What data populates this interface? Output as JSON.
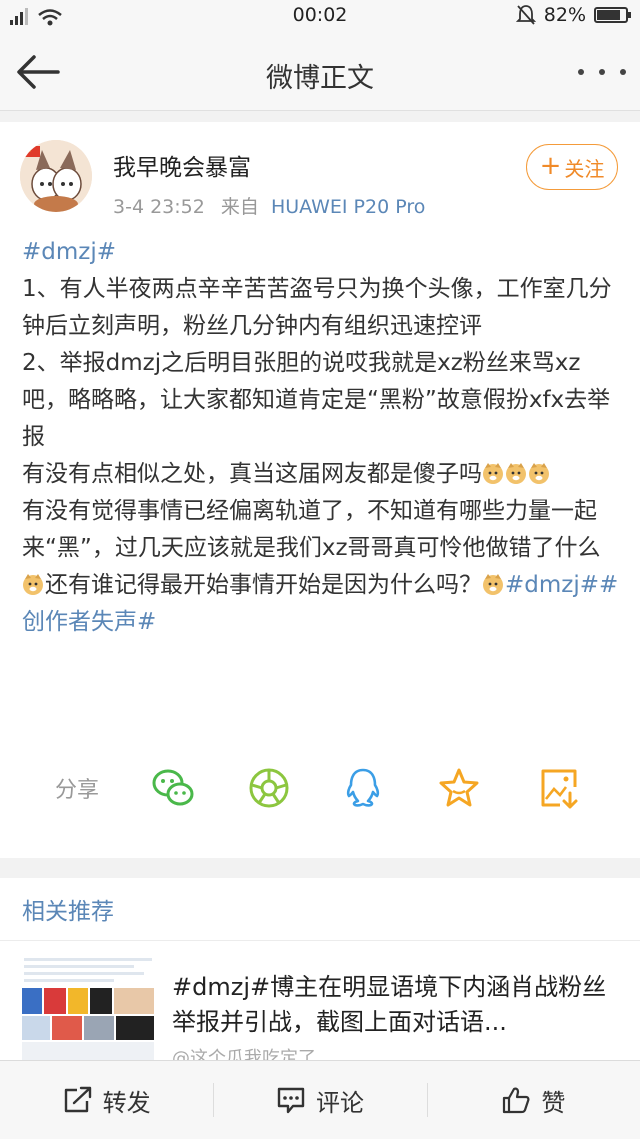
{
  "status": {
    "time": "00:02",
    "battery": "82%",
    "battery_level": 0.82
  },
  "nav": {
    "title": "微博正文"
  },
  "post": {
    "username": "我早晚会暴富",
    "time": "3-4 23:52",
    "source_prefix": "来自",
    "device": "HUAWEI P20 Pro",
    "follow_plus": "+",
    "follow_label": "关注",
    "tag1": "#dmzj#",
    "p1": "1、有人半夜两点辛辛苦苦盗号只为换个头像，工作室几分钟后立刻声明，粉丝几分钟内有组织迅速控评",
    "p2": "2、举报dmzj之后明目张胆的说哎我就是xz粉丝来骂xz吧，略略略，让大家都知道肯定是“黑粉”故意假扮xfx去举报",
    "p3": "有没有点相似之处，真当这届网友都是傻子吗",
    "p4a": "有没有觉得事情已经偏离轨道了，不知道有哪些力量一起来“黑”，过几天应该就是我们xz哥哥真可怜他做错了什么",
    "p4b": "还有谁记得最开始事情开始是因为什么吗？",
    "tag2": "#dmzj#",
    "tag3": "#创作者失声#"
  },
  "share": {
    "label": "分享"
  },
  "related": {
    "heading": "相关推荐",
    "title": "#dmzj#博主在明显语境下内涵肖战粉丝举报并引战，截图上面对话语...",
    "author": "@这个瓜我吃定了"
  },
  "actions": {
    "repost": "转发",
    "comment": "评论",
    "like": "赞"
  },
  "colors": {
    "link": "#5b87b7",
    "follow": "#f08a28",
    "wechat": "#4ab84a",
    "moments": "#8cc63f",
    "qq": "#3b9ee6",
    "favorite": "#f5a623"
  }
}
